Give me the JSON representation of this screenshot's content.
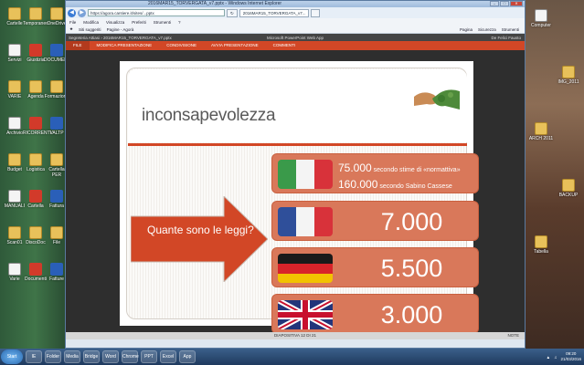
{
  "window": {
    "title": "2016MAR15_TORVERGATA_v7.pptx - Windows Internet Explorer",
    "address": "https://agora.cantiere.it/sites/...pptx",
    "tab_label": "2016MAR15_TORVERGATA_v7...",
    "min": "–",
    "max": "□",
    "close": "✕"
  },
  "menu": [
    "File",
    "Modifica",
    "Visualizza",
    "Preferiti",
    "Strumenti",
    "?"
  ],
  "favorites": {
    "suggested": "Siti suggeriti",
    "page": "Pagine - Agorà",
    "tools": [
      "Pagina",
      "Sicurezza",
      "Strumenti"
    ]
  },
  "ppt": {
    "breadcrumb": "Segreteria Attiasi  ›  2016MAR15_TORVERGATA_v7.pptx",
    "app_name": "Microsoft PowerPoint Web App",
    "user": "De Felici Fausto",
    "tabs": [
      "FILE",
      "MODIFICA PRESENTAZIONE",
      "CONDIVISIONE",
      "AVVIA PRESENTAZIONE",
      "COMMENTI"
    ],
    "status_slide": "DIAPOSITIVA 12 DI 21",
    "status_notes": "NOTE"
  },
  "slide": {
    "title": "inconsapevolezza",
    "question": "Quante sono le leggi?",
    "row1": {
      "line1_num": "75.000",
      "line1_text": " secondo stime di «normattiva»",
      "line2_num": "160.000",
      "line2_text": " secondo Sabino Cassese"
    },
    "rows": [
      {
        "country": "France",
        "value": "7.000"
      },
      {
        "country": "Germany",
        "value": "5.500"
      },
      {
        "country": "United Kingdom",
        "value": "3.000"
      }
    ],
    "colors": {
      "accent": "#d24726",
      "row": "#d9785a"
    }
  },
  "desktop_icons": [
    "Cartelle",
    "Temporaneo",
    "OneDrive",
    "Servizi",
    "Giustizia",
    "DOCUMENTI",
    "VARIE",
    "Agenda",
    "Formazione",
    "Archivio",
    "RICORRENTI",
    "VALTP",
    "Budget",
    "Logistica",
    "Cartella PER",
    "MANUALI",
    "Cartella",
    "Fattura",
    "Scan01",
    "DiscoDoc",
    "File",
    "Varie",
    "Documenti",
    "Fatture"
  ],
  "right_icons": [
    "Computer",
    "IMG_2011",
    "ARCH 2011",
    "BACKUP",
    "Tabella"
  ],
  "taskbar": {
    "start": "Start",
    "apps": [
      "IE",
      "Folder",
      "Media",
      "Bridge",
      "Word",
      "Chrome",
      "PPT",
      "Excel",
      "App"
    ],
    "time": "09:20",
    "date": "21/03/2016"
  }
}
